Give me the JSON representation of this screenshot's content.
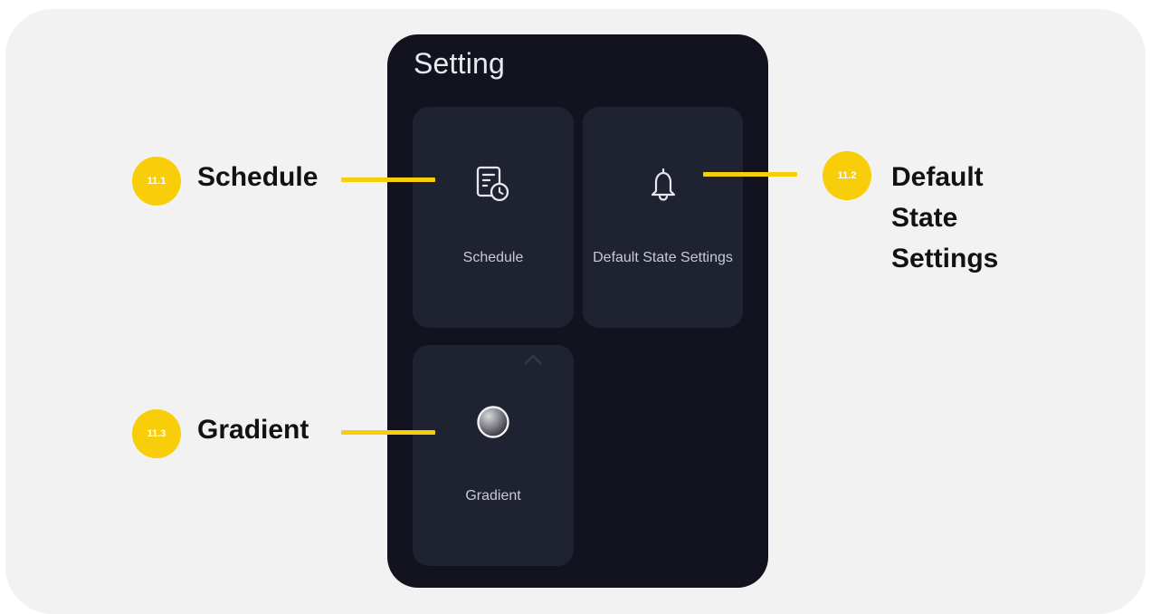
{
  "phone": {
    "title": "Setting",
    "cards": [
      {
        "label": "Schedule",
        "icon": "schedule-icon"
      },
      {
        "label": "Default State Settings",
        "icon": "bell-icon"
      },
      {
        "label": "Gradient",
        "icon": "gradient-icon"
      }
    ]
  },
  "callouts": [
    {
      "number": "11.1",
      "text": "Schedule"
    },
    {
      "number": "11.2",
      "text": "Default\nState\nSettings"
    },
    {
      "number": "11.3",
      "text": "Gradient"
    }
  ],
  "colors": {
    "accent": "#f8cd0a",
    "phone_bg": "#12131e",
    "card_bg": "#1f2230",
    "frame_bg": "#f2f2f2"
  }
}
